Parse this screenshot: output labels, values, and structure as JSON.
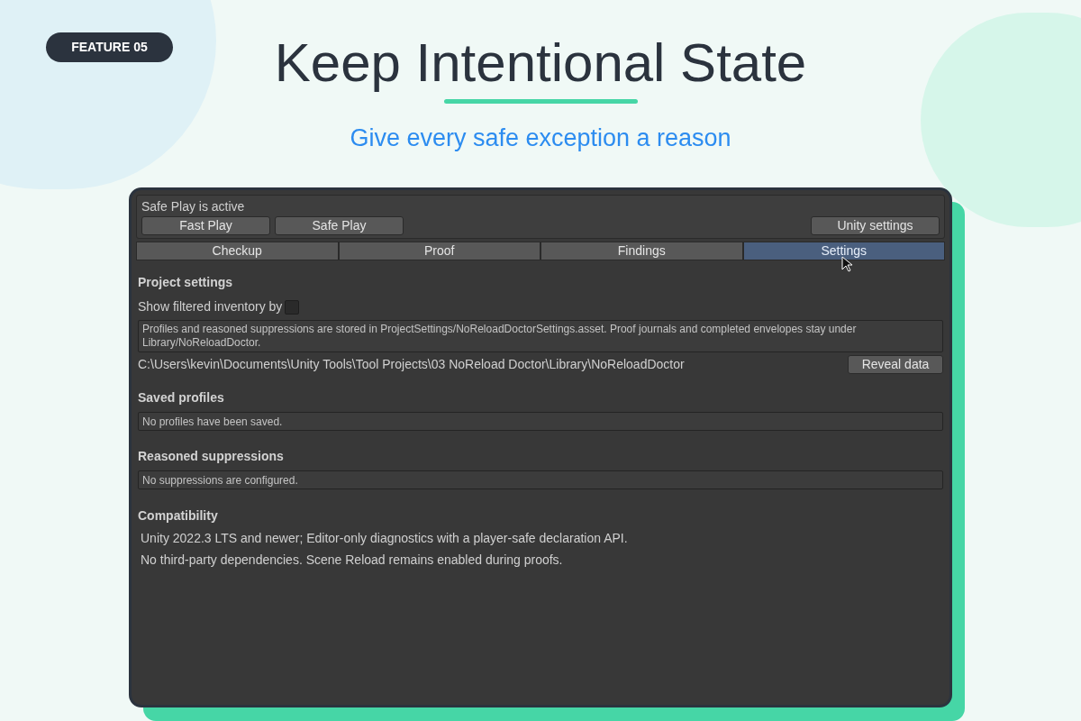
{
  "badge": "FEATURE 05",
  "title": "Keep Intentional State",
  "subtitle": "Give every safe exception a reason",
  "panel": {
    "status": "Safe Play is active",
    "play_buttons": [
      "Fast Play",
      "Safe Play"
    ],
    "settings_button": "Unity settings",
    "tabs": [
      {
        "label": "Checkup",
        "selected": false
      },
      {
        "label": "Proof",
        "selected": false
      },
      {
        "label": "Findings",
        "selected": false
      },
      {
        "label": "Settings",
        "selected": true
      }
    ],
    "project_settings": {
      "heading": "Project settings",
      "toggle_label": "Show filtered inventory by",
      "checked": false,
      "info": "Profiles and reasoned suppressions are stored in ProjectSettings/NoReloadDoctorSettings.asset. Proof journals and completed envelopes stay under Library/NoReloadDoctor.",
      "path": "C:\\Users\\kevin\\Documents\\Unity Tools\\Tool Projects\\03 NoReload Doctor\\Library\\NoReloadDoctor",
      "reveal_button": "Reveal data"
    },
    "saved_profiles": {
      "heading": "Saved profiles",
      "message": "No profiles have been saved."
    },
    "suppressions": {
      "heading": "Reasoned suppressions",
      "message": "No suppressions are configured."
    },
    "compatibility": {
      "heading": "Compatibility",
      "lines": [
        "Unity 2022.3 LTS and newer; Editor-only diagnostics with a player-safe declaration API.",
        "No third-party dependencies. Scene Reload remains enabled during proofs."
      ]
    }
  }
}
